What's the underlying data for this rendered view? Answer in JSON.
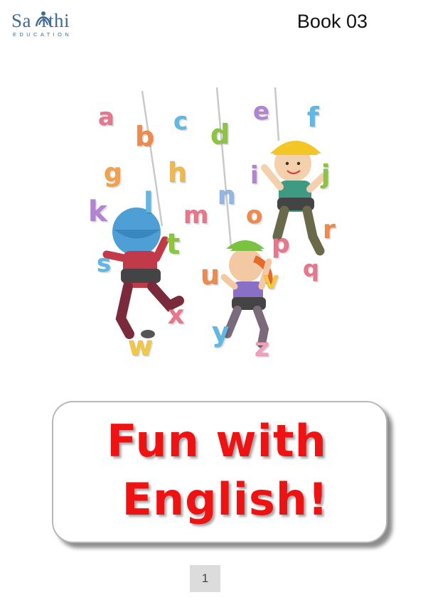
{
  "header": {
    "logo": {
      "brand": "Sa  rthi",
      "tagline": "EDUCATION"
    },
    "book_label": "Book 03"
  },
  "illustration": {
    "letters": [
      "a",
      "b",
      "c",
      "d",
      "e",
      "f",
      "g",
      "h",
      "i",
      "j",
      "k",
      "l",
      "m",
      "n",
      "o",
      "p",
      "q",
      "r",
      "s",
      "t",
      "u",
      "v",
      "w",
      "x",
      "y",
      "z"
    ],
    "letter_colors": [
      "#e8768c",
      "#f08a4b",
      "#5fb9e6",
      "#8cc63f",
      "#b384d6",
      "#5fb9e6",
      "#f5a04b",
      "#f5b841",
      "#b384d6",
      "#8cc63f",
      "#b384d6",
      "#5fb9e6",
      "#e8768c",
      "#8fb8e6",
      "#f08a4b",
      "#e8768c",
      "#e8768c",
      "#f08a4b",
      "#5fb9e6",
      "#8cc63f",
      "#f08a4b",
      "#f5c842",
      "#f5c842",
      "#e8768c",
      "#5fb9e6",
      "#f0a0b8"
    ]
  },
  "title": {
    "line1": "Fun with",
    "line2": "English!",
    "color": "#ee1212"
  },
  "footer": {
    "page_number": "1"
  }
}
